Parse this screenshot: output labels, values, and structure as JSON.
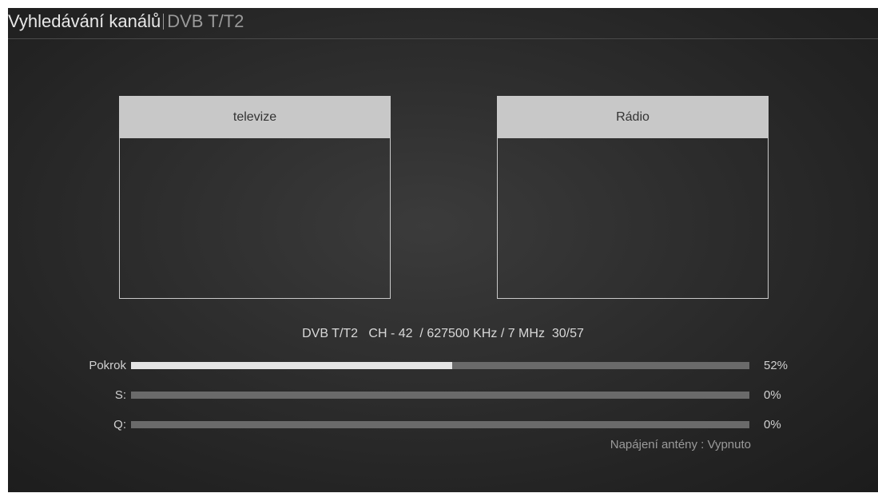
{
  "header": {
    "title": "Vyhledávání kanálů",
    "subtitle": "DVB T/T2"
  },
  "panels": {
    "tv": {
      "label": "televize"
    },
    "radio": {
      "label": "Rádio"
    }
  },
  "scan_info": "DVB T/T2   CH - 42  / 627500 KHz / 7 MHz  30/57",
  "meters": {
    "progress": {
      "label": "Pokrok",
      "value_text": "52%",
      "fraction": 0.52
    },
    "signal": {
      "label": "S:",
      "value_text": "0%",
      "fraction": 0
    },
    "quality": {
      "label": "Q:",
      "value_text": "0%",
      "fraction": 0
    }
  },
  "antenna_power": "Napájení antény : Vypnuto",
  "colors": {
    "bar_fill": "#e4e4e4",
    "bar_track": "#6a6a6a",
    "panel_header": "#c8c8c8"
  }
}
